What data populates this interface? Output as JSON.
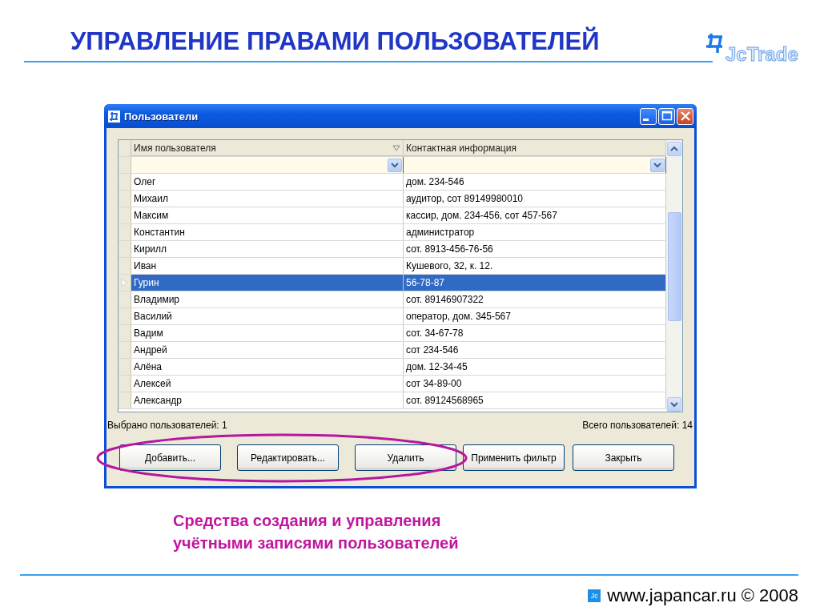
{
  "slide": {
    "title": "УПРАВЛЕНИЕ ПРАВАМИ ПОЛЬЗОВАТЕЛЕЙ",
    "logo": "JcTrade"
  },
  "window": {
    "title": "Пользователи"
  },
  "grid": {
    "columns": [
      {
        "label": "Имя пользователя",
        "sorted": true
      },
      {
        "label": "Контактная информация",
        "sorted": false
      }
    ],
    "rows": [
      {
        "name": "Олег",
        "contact": "дом. 234-546",
        "selected": false
      },
      {
        "name": "Михаил",
        "contact": "аудитор, сот 89149980010",
        "selected": false
      },
      {
        "name": "Максим",
        "contact": "кассир, дом. 234-456, сот 457-567",
        "selected": false
      },
      {
        "name": "Константин",
        "contact": "администратор",
        "selected": false
      },
      {
        "name": "Кирилл",
        "contact": "сот. 8913-456-76-56",
        "selected": false
      },
      {
        "name": "Иван",
        "contact": "Кушевого, 32, к. 12.",
        "selected": false
      },
      {
        "name": "Гурин",
        "contact": "56-78-87",
        "selected": true
      },
      {
        "name": "Владимир",
        "contact": "сот. 89146907322",
        "selected": false
      },
      {
        "name": "Василий",
        "contact": "оператор, дом. 345-567",
        "selected": false
      },
      {
        "name": "Вадим",
        "contact": "сот. 34-67-78",
        "selected": false
      },
      {
        "name": "Андрей",
        "contact": "сот 234-546",
        "selected": false
      },
      {
        "name": "Алёна",
        "contact": "дом. 12-34-45",
        "selected": false
      },
      {
        "name": "Алексей",
        "contact": "сот 34-89-00",
        "selected": false
      },
      {
        "name": "Александр",
        "contact": "сот. 89124568965",
        "selected": false
      }
    ]
  },
  "status": {
    "selected_count": "Выбрано пользователей: 1",
    "total_count": "Всего пользователей: 14"
  },
  "buttons": [
    "Добавить...",
    "Редактировать...",
    "Удалить",
    "Применить фильтр",
    "Закрыть"
  ],
  "caption": "Средства создания и управления\nучётными записями пользователей",
  "footer": {
    "badge": "Jc",
    "text": "www.japancar.ru © 2008"
  }
}
